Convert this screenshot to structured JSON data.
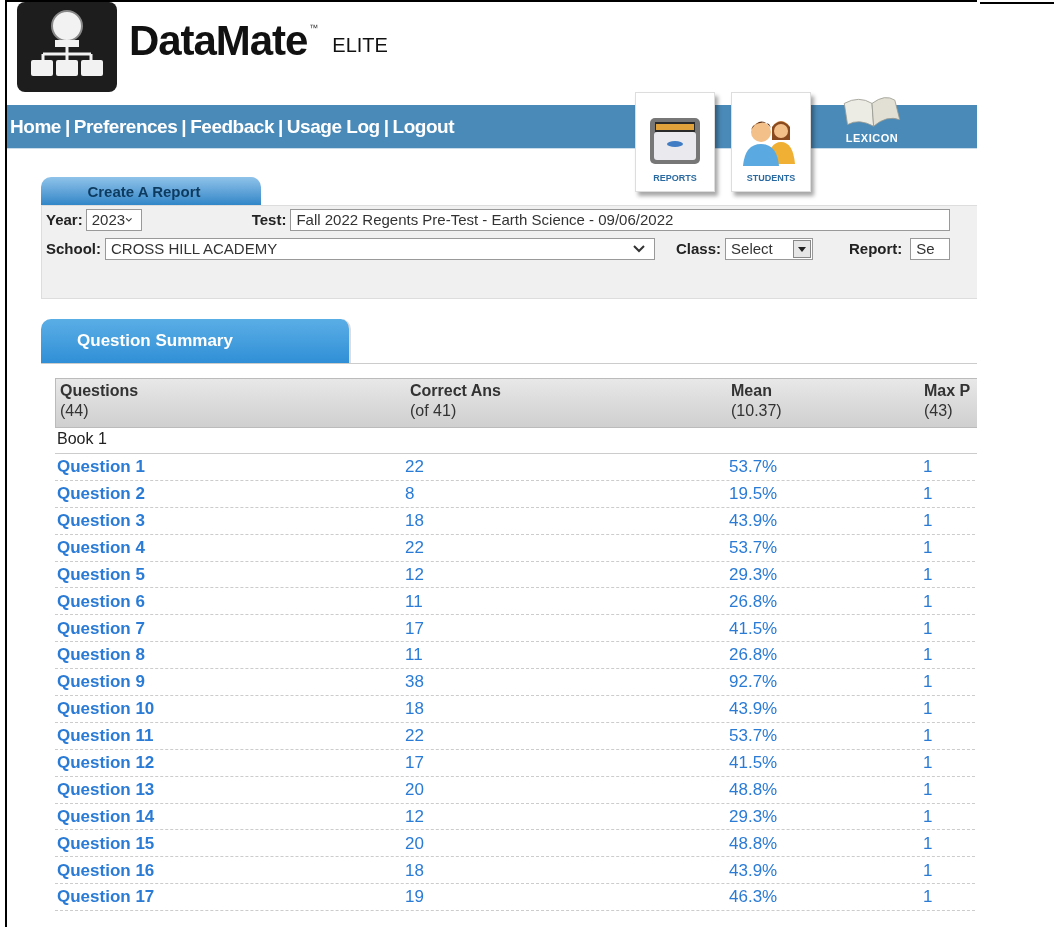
{
  "brand": {
    "name": "DataMate",
    "trademark": "™",
    "edition": "ELITE"
  },
  "nav": [
    {
      "label": "Home"
    },
    {
      "label": "Preferences"
    },
    {
      "label": "Feedback"
    },
    {
      "label": "Usage Log"
    },
    {
      "label": "Logout"
    }
  ],
  "nav_separators": [
    "|",
    "|",
    "|",
    "|"
  ],
  "modules": [
    {
      "kind": "reports",
      "label": "REPORTS"
    },
    {
      "kind": "students",
      "label": "STUDENTS"
    },
    {
      "kind": "lexicon",
      "label": "LEXICON"
    }
  ],
  "create_report": {
    "tab": "Create A Report",
    "year": {
      "label": "Year:",
      "value": "2023"
    },
    "test": {
      "label": "Test:",
      "value": "Fall 2022 Regents Pre-Test - Earth Science - 09/06/2022"
    },
    "school": {
      "label": "School:",
      "value": "CROSS HILL ACADEMY"
    },
    "class": {
      "label": "Class:",
      "value": "Select"
    },
    "report": {
      "label": "Report:",
      "value": "Se"
    }
  },
  "summary": {
    "tab": "Question Summary",
    "columns": [
      {
        "title": "Questions",
        "sub": "(44)"
      },
      {
        "title": "Correct Ans",
        "sub": "(of 41)"
      },
      {
        "title": "Mean",
        "sub": "(10.37)"
      },
      {
        "title": "Max P",
        "sub": "(43)"
      }
    ],
    "group": "Book 1",
    "rows": [
      {
        "question": "Question 1",
        "correct": "22",
        "mean": "53.7%",
        "max": "1"
      },
      {
        "question": "Question 2",
        "correct": "8",
        "mean": "19.5%",
        "max": "1"
      },
      {
        "question": "Question 3",
        "correct": "18",
        "mean": "43.9%",
        "max": "1"
      },
      {
        "question": "Question 4",
        "correct": "22",
        "mean": "53.7%",
        "max": "1"
      },
      {
        "question": "Question 5",
        "correct": "12",
        "mean": "29.3%",
        "max": "1"
      },
      {
        "question": "Question 6",
        "correct": "11",
        "mean": "26.8%",
        "max": "1"
      },
      {
        "question": "Question 7",
        "correct": "17",
        "mean": "41.5%",
        "max": "1"
      },
      {
        "question": "Question 8",
        "correct": "11",
        "mean": "26.8%",
        "max": "1"
      },
      {
        "question": "Question 9",
        "correct": "38",
        "mean": "92.7%",
        "max": "1"
      },
      {
        "question": "Question 10",
        "correct": "18",
        "mean": "43.9%",
        "max": "1"
      },
      {
        "question": "Question 11",
        "correct": "22",
        "mean": "53.7%",
        "max": "1"
      },
      {
        "question": "Question 12",
        "correct": "17",
        "mean": "41.5%",
        "max": "1"
      },
      {
        "question": "Question 13",
        "correct": "20",
        "mean": "48.8%",
        "max": "1"
      },
      {
        "question": "Question 14",
        "correct": "12",
        "mean": "29.3%",
        "max": "1"
      },
      {
        "question": "Question 15",
        "correct": "20",
        "mean": "48.8%",
        "max": "1"
      },
      {
        "question": "Question 16",
        "correct": "18",
        "mean": "43.9%",
        "max": "1"
      },
      {
        "question": "Question 17",
        "correct": "19",
        "mean": "46.3%",
        "max": "1"
      }
    ]
  }
}
